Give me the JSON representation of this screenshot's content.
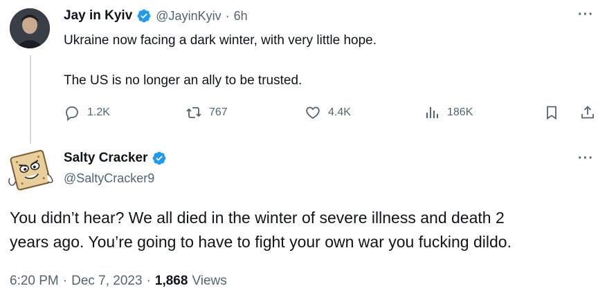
{
  "tweet1": {
    "name": "Jay in Kyiv",
    "handle": "@JayinKyiv",
    "dot": "·",
    "time": "6h",
    "more": "···",
    "line1": "Ukraine now facing a dark winter, with very little hope.",
    "line2": "The US is no longer an ally to be trusted.",
    "stats": {
      "replies": "1.2K",
      "reposts": "767",
      "likes": "4.4K",
      "views": "186K"
    },
    "icons": [
      "reply-icon",
      "repost-icon",
      "like-icon",
      "views-icon",
      "bookmark-icon",
      "share-icon"
    ]
  },
  "tweet2": {
    "name": "Salty Cracker",
    "handle": "@SaltyCracker9",
    "more": "···",
    "line1": "You didn’t hear? We all died in the winter of severe illness and death 2",
    "line2": "years ago. You’re going to have to fight your own war you fucking dildo.",
    "footer": {
      "time": "6:20 PM",
      "sep1": "·",
      "date": "Dec 7, 2023",
      "sep2": "·",
      "views_count": "1,868",
      "views_label": "Views"
    }
  },
  "colors": {
    "verified": "#1d9bf0",
    "text": "#0f1419",
    "muted": "#536471",
    "thread": "#cfd9de"
  }
}
